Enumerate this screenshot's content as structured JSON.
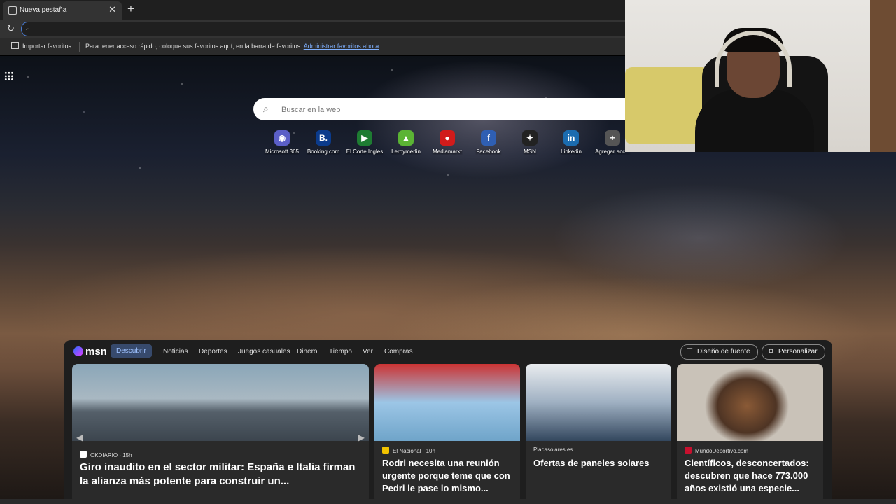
{
  "browser": {
    "tab_title": "Nueva pestaña",
    "tab_close": "✕",
    "new_tab": "+",
    "reload": "↻",
    "omnibox_icon": "⌕"
  },
  "favorites_bar": {
    "import_label": "Importar favoritos",
    "message": "Para tener acceso rápido, coloque sus favoritos aquí, en la barra de favoritos.",
    "manage_link": "Administrar favoritos ahora"
  },
  "search": {
    "placeholder": "Buscar en la web",
    "icon": "⌕"
  },
  "quick_links": [
    {
      "label": "Microsoft 365",
      "glyph": "◉",
      "color": "#5b5fc7"
    },
    {
      "label": "Booking.com",
      "glyph": "B.",
      "color": "#0b3b8c"
    },
    {
      "label": "El Corte Ingles",
      "glyph": "▶",
      "color": "#1e7c32"
    },
    {
      "label": "Leroymerlin",
      "glyph": "▲",
      "color": "#5bb434"
    },
    {
      "label": "Mediamarkt",
      "glyph": "●",
      "color": "#d11b1b"
    },
    {
      "label": "Facebook",
      "glyph": "f",
      "color": "#2f5fb3"
    },
    {
      "label": "MSN",
      "glyph": "✦",
      "color": "#222222"
    },
    {
      "label": "Linkedin",
      "glyph": "in",
      "color": "#1b6cb0"
    },
    {
      "label": "Agregar acc...",
      "glyph": "+",
      "color": "#555555"
    }
  ],
  "msn": {
    "logo": "msn",
    "tabs": [
      "Descubrir",
      "Noticias",
      "Deportes",
      "Juegos casuales",
      "Dinero",
      "Tiempo",
      "Ver",
      "Compras"
    ],
    "font_button": "Diseño de fuente",
    "personalize_button": "Personalizar"
  },
  "cards": [
    {
      "source": "OKDIARIO",
      "time": "15h",
      "meta": "OKDIARIO · 15h",
      "title": "Giro inaudito en el sector militar: España e Italia firman la alianza más potente para construir un...",
      "src_color": "#ffffff"
    },
    {
      "source": "El Nacional",
      "time": "10h",
      "meta": "El Nacional · 10h",
      "title": "Rodri necesita una reunión urgente porque teme que con Pedri le pase lo mismo...",
      "src_color": "#f2c300"
    },
    {
      "source": "Placasolares.es",
      "meta": "Placasolares.es",
      "title": "Ofertas de paneles solares",
      "src_color": "#2a2a2a"
    },
    {
      "source": "MundoDeportivo.com",
      "meta": "MundoDeportivo.com",
      "title": "Científicos, desconcertados: descubren que hace 773.000 años existió una especie...",
      "src_color": "#c8102e"
    }
  ]
}
